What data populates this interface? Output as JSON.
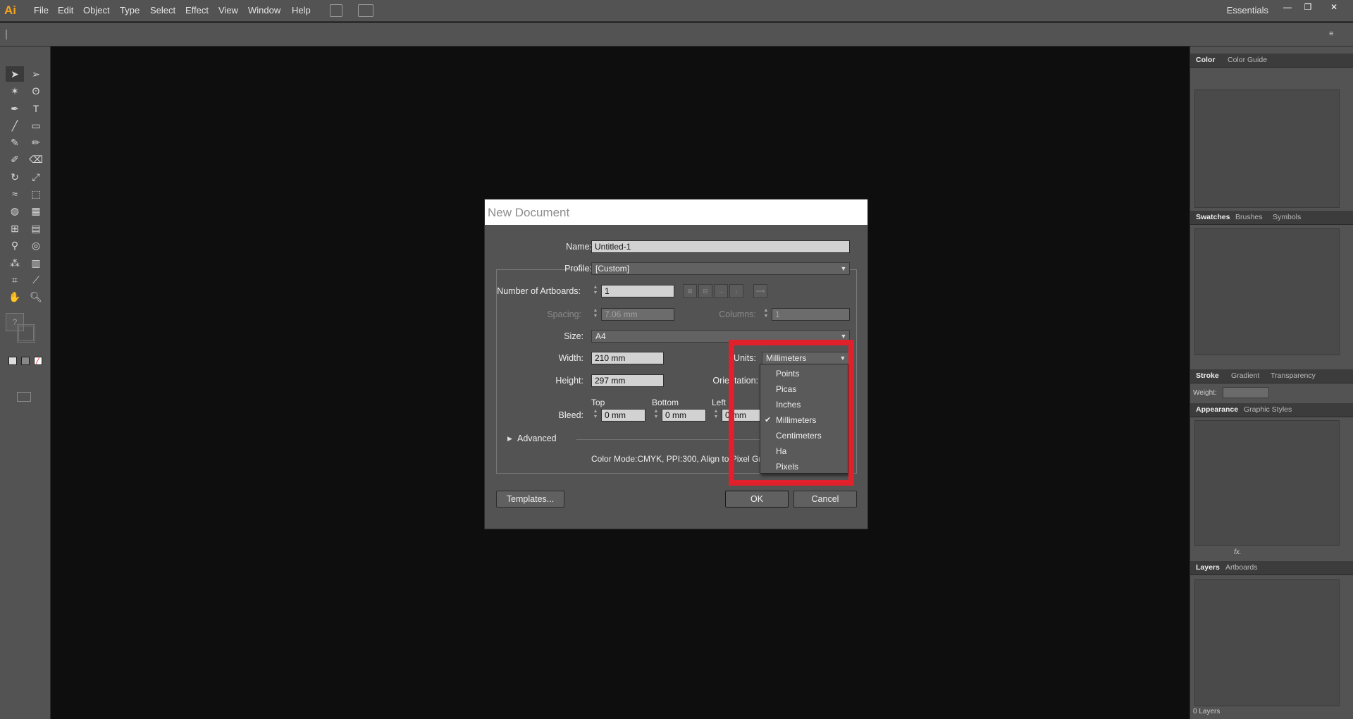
{
  "app": {
    "logo": "Ai",
    "workspace": "Essentials"
  },
  "menu": [
    "File",
    "Edit",
    "Object",
    "Type",
    "Select",
    "Effect",
    "View",
    "Window",
    "Help"
  ],
  "window_controls": {
    "minimize": "—",
    "restore": "❐",
    "close": "✕"
  },
  "dialog": {
    "title": "New Document",
    "name_label": "Name:",
    "name_value": "Untitled-1",
    "profile_label": "Profile:",
    "profile_value": "[Custom]",
    "artboards_label": "Number of Artboards:",
    "artboards_value": "1",
    "spacing_label": "Spacing:",
    "spacing_value": "7.06 mm",
    "columns_label": "Columns:",
    "columns_value": "1",
    "size_label": "Size:",
    "size_value": "A4",
    "width_label": "Width:",
    "width_value": "210 mm",
    "units_label": "Units:",
    "units_value": "Millimeters",
    "height_label": "Height:",
    "height_value": "297 mm",
    "orientation_label": "Orientation:",
    "bleed_label": "Bleed:",
    "bleed_top_label": "Top",
    "bleed_top_value": "0 mm",
    "bleed_bottom_label": "Bottom",
    "bleed_bottom_value": "0 mm",
    "bleed_left_label": "Left",
    "bleed_left_value": "0 mm",
    "advanced_label": "Advanced",
    "info_text": "Color Mode:CMYK, PPI:300, Align to Pixel Grid:No",
    "templates_button": "Templates...",
    "ok_button": "OK",
    "cancel_button": "Cancel"
  },
  "units_menu": {
    "items": [
      "Points",
      "Picas",
      "Inches",
      "Millimeters",
      "Centimeters",
      "Ha",
      "Pixels"
    ],
    "selected": "Millimeters"
  },
  "panels": {
    "color_tabs": [
      "Color",
      "Color Guide"
    ],
    "swatch_tabs": [
      "Swatches",
      "Brushes",
      "Symbols"
    ],
    "stroke_tabs": [
      "Stroke",
      "Gradient",
      "Transparency"
    ],
    "weight_label": "Weight:",
    "appearance_tabs": [
      "Appearance",
      "Graphic Styles"
    ],
    "layers_tabs": [
      "Layers",
      "Artboards"
    ],
    "layers_count": "0 Layers",
    "fx_label": "fx."
  },
  "toolbox": {
    "unknown_tool": "?"
  }
}
